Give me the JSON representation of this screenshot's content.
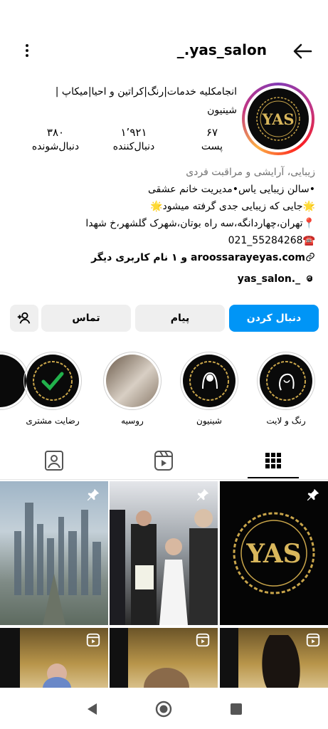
{
  "header": {
    "username": "_.yas_salon",
    "back_icon": "arrow-left-icon",
    "menu_icon": "more-vertical-icon"
  },
  "profile": {
    "avatar_text": "YAS",
    "title_line1": "انجامکلیه خدمات|رنگ|کراتین و احیا|میکاپ |",
    "title_line2": "شینیون",
    "stats": [
      {
        "value": "۶۷",
        "label": "پست"
      },
      {
        "value": "۱٬۹۲۱",
        "label": "دنبال‌کننده"
      },
      {
        "value": "۳۸۰",
        "label": "دنبال‌شونده"
      }
    ],
    "category": "زیبایی، آرایشی و مراقبت فردی",
    "bio": [
      "•سالن زیبایی یاس•مدیریت خانم عشقی",
      "🌟جایی که زیبایی جدی گرفته میشود🌟",
      "📍تهران،چهاردانگه،سه راه بوتان،شهرک گلشهر،خ شهدا",
      "☎️55284268_021"
    ],
    "link_text": "aroossarayeyas.com",
    "link_suffix": "و ۱ نام کاربری دیگر",
    "threads_handle": "_.yas_salon"
  },
  "buttons": {
    "follow": "دنبال کردن",
    "message": "پیام",
    "contact": "تماس"
  },
  "highlights": [
    {
      "label": "رنگ و لایت"
    },
    {
      "label": "شینیون"
    },
    {
      "label": "روسیه"
    },
    {
      "label": "رضایت مشتری"
    }
  ],
  "tabs": [
    "grid-tab",
    "reels-tab",
    "tagged-tab"
  ],
  "grid": {
    "tile_logo": "YAS"
  },
  "colors": {
    "accent": "#0095f6",
    "gold": "#c9a54a",
    "dark": "#0b0b0b"
  }
}
